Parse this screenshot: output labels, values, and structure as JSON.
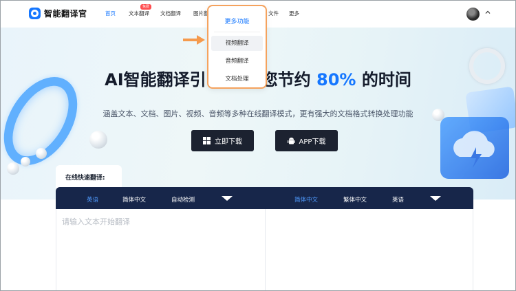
{
  "app": {
    "name": "智能翻译官"
  },
  "nav": {
    "items": [
      {
        "label": "首页",
        "active": true
      },
      {
        "label": "文本翻译",
        "badge": "免费"
      },
      {
        "label": "文档翻译"
      },
      {
        "label": "图片翻译"
      },
      {
        "label": "文件"
      },
      {
        "label": "更多"
      }
    ]
  },
  "dropdown": {
    "title": "更多功能",
    "items": [
      "视频翻译",
      "音频翻译",
      "文档处理"
    ],
    "selected_index": 0
  },
  "hero": {
    "title_prefix": "AI智能翻译引",
    "title_middle": "您节约",
    "title_highlight": "80%",
    "title_suffix": "的时间",
    "subtitle": "涵盖文本、文档、图片、视频、音频等多种在线翻译模式，更有强大的文档格式转换处理功能",
    "buttons": {
      "download": "立即下载",
      "app_download": "APP下载"
    }
  },
  "translator": {
    "section_label": "在线快速翻译:",
    "source_langs": [
      "英语",
      "简体中文",
      "自动检测"
    ],
    "source_active": 0,
    "target_langs": [
      "简体中文",
      "繁体中文",
      "英语"
    ],
    "target_active": 0,
    "placeholder": "请输入文本开始翻译"
  },
  "colors": {
    "accent": "#1677ff",
    "dark_button": "#1c2230",
    "panel_bar": "#17264a",
    "dropdown_border": "#f5a25d"
  }
}
